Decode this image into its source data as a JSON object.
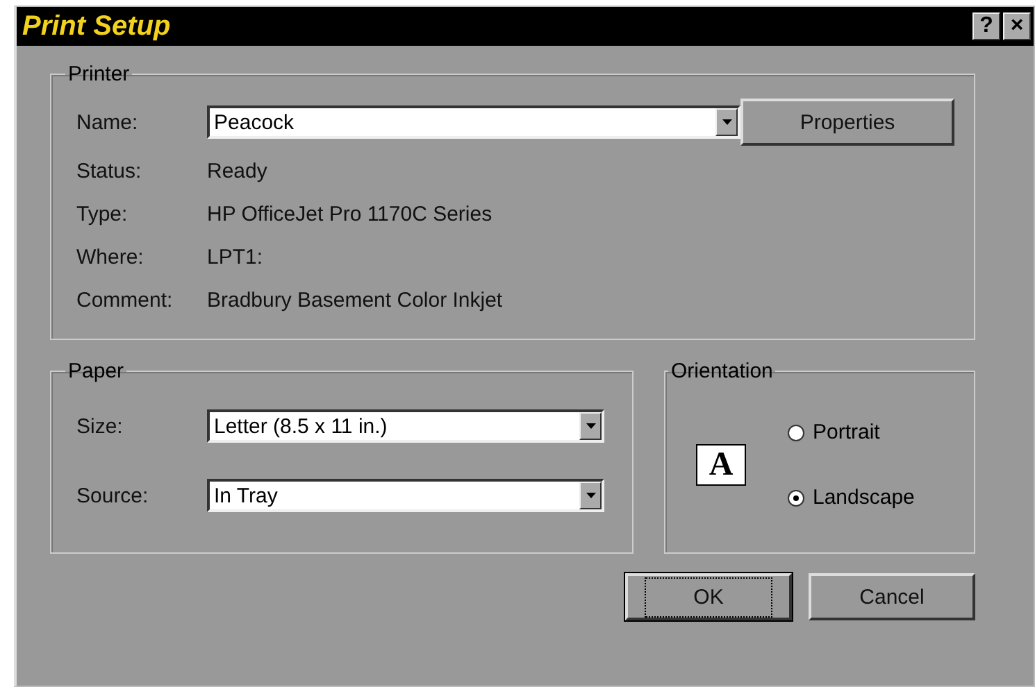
{
  "window": {
    "title": "Print Setup",
    "title_buttons": [
      "?",
      "×"
    ]
  },
  "printer": {
    "label": "Printer",
    "name": {
      "label": "Name:",
      "value": "Peacock"
    },
    "properties_button": {
      "label": "Properties"
    },
    "info": [
      {
        "label": "Status:",
        "value": "Ready"
      },
      {
        "label": "Type:",
        "value": "HP OfficeJet Pro 1170C Series"
      },
      {
        "label": "Where:",
        "value": "LPT1:"
      },
      {
        "label": "Comment:",
        "value": "Bradbury Basement Color Inkjet"
      }
    ]
  },
  "paper": {
    "label": "Paper",
    "fields": [
      {
        "label": "Size:",
        "value": "Letter (8.5 x 11 in.)"
      },
      {
        "label": "Source:",
        "value": "In Tray"
      }
    ]
  },
  "orientation": {
    "label": "Orientation",
    "icon_letter": "A",
    "options": [
      {
        "label": "Portrait",
        "selected": false
      },
      {
        "label": "Landscape",
        "selected": true
      }
    ]
  },
  "buttons": [
    {
      "label": "OK",
      "default": true
    },
    {
      "label": "Cancel",
      "default": false
    }
  ]
}
